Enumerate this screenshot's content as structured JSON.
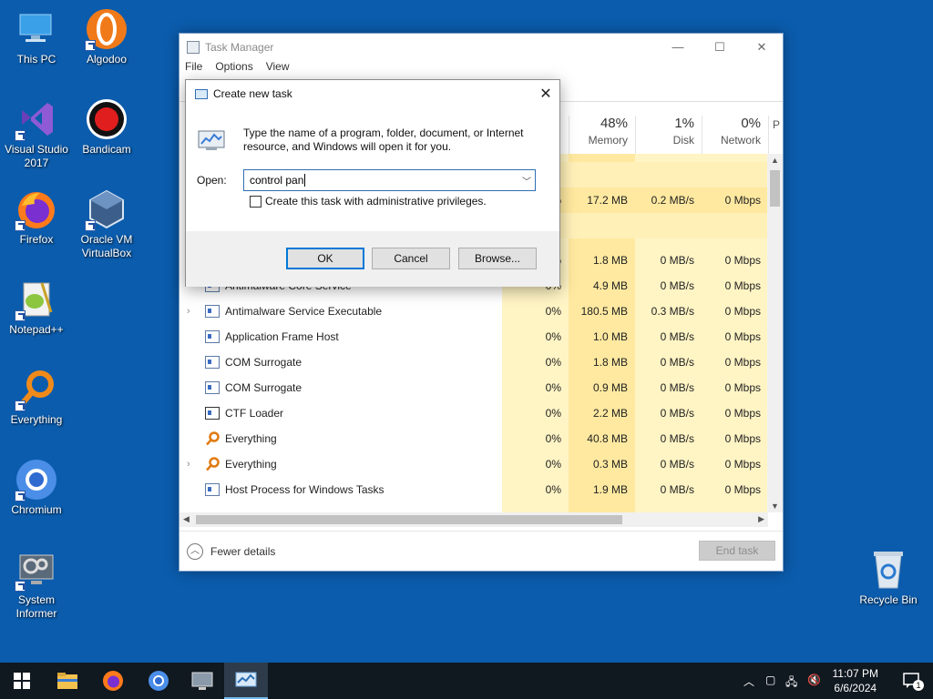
{
  "desktop": {
    "icons": [
      {
        "label": "This PC"
      },
      {
        "label": "Algodoo"
      },
      {
        "label": "Visual Studio 2017"
      },
      {
        "label": "Bandicam"
      },
      {
        "label": "Firefox"
      },
      {
        "label": "Oracle VM VirtualBox"
      },
      {
        "label": "Notepad++"
      },
      {
        "label": "Everything"
      },
      {
        "label": "Chromium"
      },
      {
        "label": "System Informer"
      },
      {
        "label": "Recycle Bin"
      }
    ]
  },
  "task_manager": {
    "title": "Task Manager",
    "menu": [
      "File",
      "Options",
      "View"
    ],
    "columns": [
      {
        "pct": "48%",
        "label": "Memory"
      },
      {
        "pct": "1%",
        "label": "Disk"
      },
      {
        "pct": "0%",
        "label": "Network"
      },
      {
        "pct": "",
        "label": "P"
      }
    ],
    "rows": [
      {
        "name": "",
        "cpu": "",
        "mem": "17.2 MB",
        "disk": "0.2 MB/s",
        "net": "0 Mbps",
        "cpu_frag": "%"
      },
      {
        "name": "",
        "cpu": "",
        "mem": "1.8 MB",
        "disk": "0 MB/s",
        "net": "0 Mbps",
        "cpu_frag": "%"
      },
      {
        "name": "Antimalware Core Service",
        "cpu": "0%",
        "mem": "4.9 MB",
        "disk": "0 MB/s",
        "net": "0 Mbps"
      },
      {
        "name": "Antimalware Service Executable",
        "cpu": "0%",
        "mem": "180.5 MB",
        "disk": "0.3 MB/s",
        "net": "0 Mbps",
        "expand": "›"
      },
      {
        "name": "Application Frame Host",
        "cpu": "0%",
        "mem": "1.0 MB",
        "disk": "0 MB/s",
        "net": "0 Mbps"
      },
      {
        "name": "COM Surrogate",
        "cpu": "0%",
        "mem": "1.8 MB",
        "disk": "0 MB/s",
        "net": "0 Mbps"
      },
      {
        "name": "COM Surrogate",
        "cpu": "0%",
        "mem": "0.9 MB",
        "disk": "0 MB/s",
        "net": "0 Mbps"
      },
      {
        "name": "CTF Loader",
        "cpu": "0%",
        "mem": "2.2 MB",
        "disk": "0 MB/s",
        "net": "0 Mbps"
      },
      {
        "name": "Everything",
        "cpu": "0%",
        "mem": "40.8 MB",
        "disk": "0 MB/s",
        "net": "0 Mbps"
      },
      {
        "name": "Everything",
        "cpu": "0%",
        "mem": "0.3 MB",
        "disk": "0 MB/s",
        "net": "0 Mbps",
        "expand": "›"
      },
      {
        "name": "Host Process for Windows Tasks",
        "cpu": "0%",
        "mem": "1.9 MB",
        "disk": "0 MB/s",
        "net": "0 Mbps"
      }
    ],
    "fewer_details": "Fewer details",
    "end_task": "End task"
  },
  "run_dialog": {
    "title": "Create new task",
    "message": "Type the name of a program, folder, document, or Internet resource, and Windows will open it for you.",
    "open_label": "Open:",
    "input_value": "control pan",
    "admin_checkbox": "Create this task with administrative privileges.",
    "ok": "OK",
    "cancel": "Cancel",
    "browse": "Browse..."
  },
  "taskbar": {
    "time": "11:07 PM",
    "date": "6/6/2024",
    "notifications": "1"
  }
}
